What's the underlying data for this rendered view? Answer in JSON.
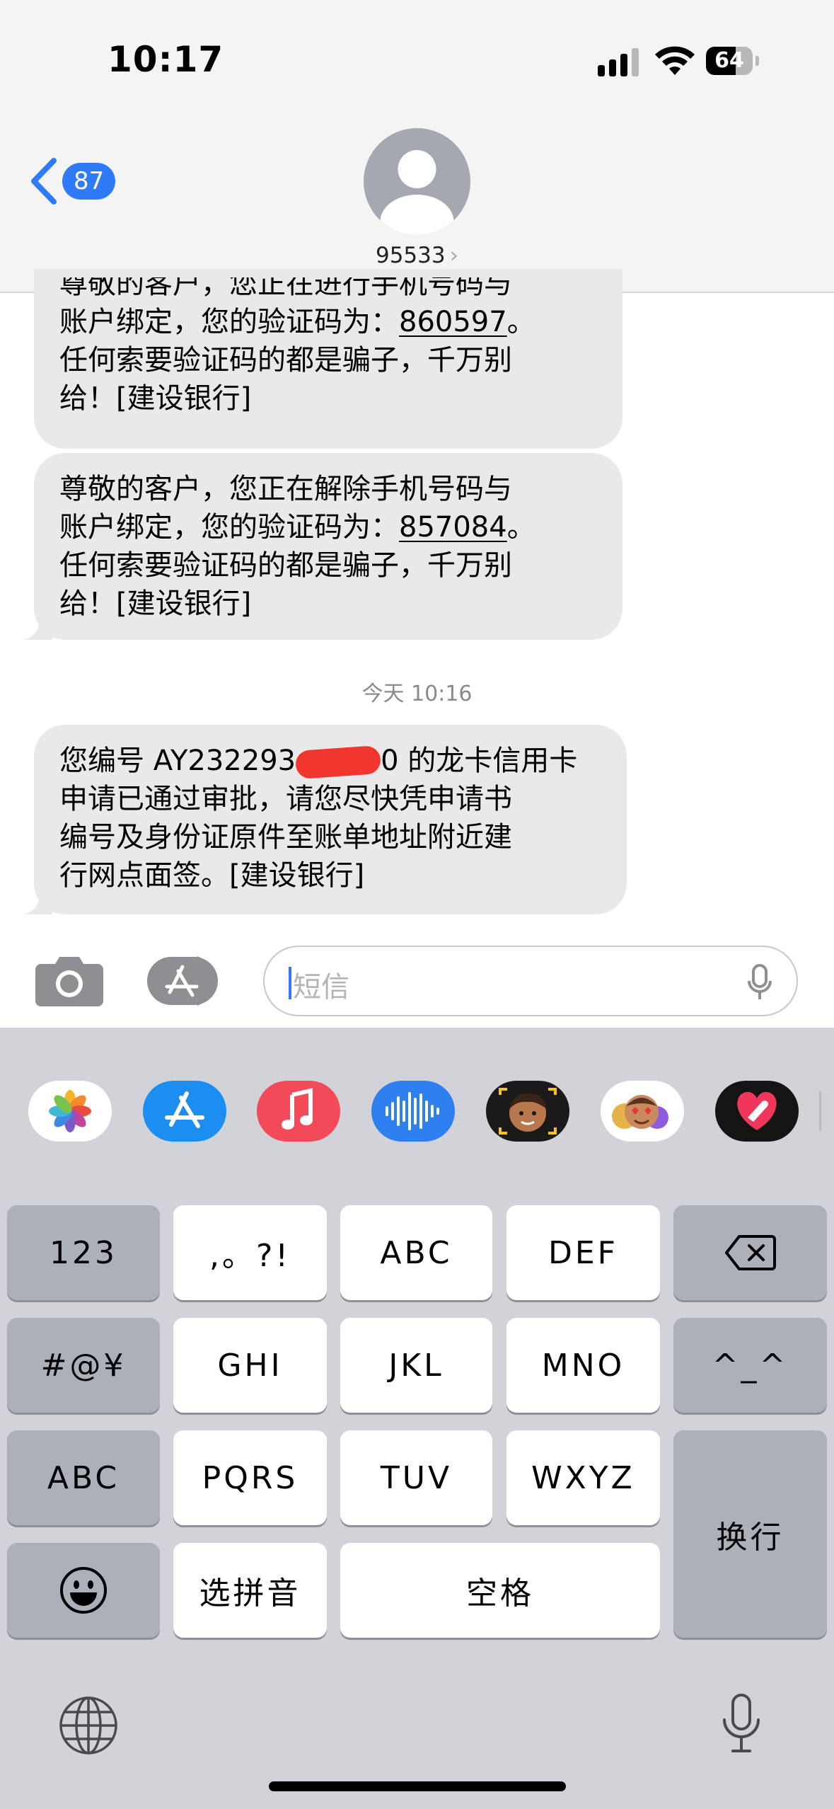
{
  "status_bar": {
    "time": "10:17",
    "battery_level": "64",
    "battery_fraction": 0.64
  },
  "header": {
    "back_badge": "87",
    "contact_name": "95533",
    "contact_chevron": "›"
  },
  "messages": [
    {
      "lines": [
        "尊敬的客户，您正在进行手机号码与",
        "账户绑定，您的验证码为：",
        "任何索要验证码的都是骗子，千万别",
        "给！[建设银行]"
      ],
      "code": "860597",
      "code_suffix": "。"
    },
    {
      "lines": [
        "尊敬的客户，您正在解除手机号码与",
        "账户绑定，您的验证码为：",
        "任何索要验证码的都是骗子，千万别",
        "给！[建设银行]"
      ],
      "code": "857084",
      "code_suffix": "。"
    },
    {
      "line1_prefix": "您编号 AY232293",
      "line1_suffix": "0 的龙卡信用卡",
      "lines": [
        "申请已通过审批，请您尽快凭申请书",
        "编号及身份证原件至账单地址附近建",
        "行网点面签。[建设银行]"
      ]
    }
  ],
  "timestamp": "今天 10:16",
  "input": {
    "placeholder": "短信"
  },
  "app_strip": [
    "photos-icon",
    "app-store-icon",
    "music-icon",
    "audio-message-icon",
    "memoji-camera-icon",
    "memoji-stickers-icon",
    "digital-touch-icon"
  ],
  "keyboard": {
    "row1": [
      "123",
      ",。?!",
      "ABC",
      "DEF"
    ],
    "row2": [
      "#@¥",
      "GHI",
      "JKL",
      "MNO",
      "^_^"
    ],
    "row3": [
      "ABC",
      "PQRS",
      "TUV",
      "WXYZ"
    ],
    "row4": [
      "选拼音",
      "空格"
    ],
    "return": "换行"
  },
  "colors": {
    "accent": "#2f7af6",
    "bubble": "#e9e9eb",
    "keyboard_bg": "#d1d3d9",
    "function_key": "#acb0b8"
  }
}
